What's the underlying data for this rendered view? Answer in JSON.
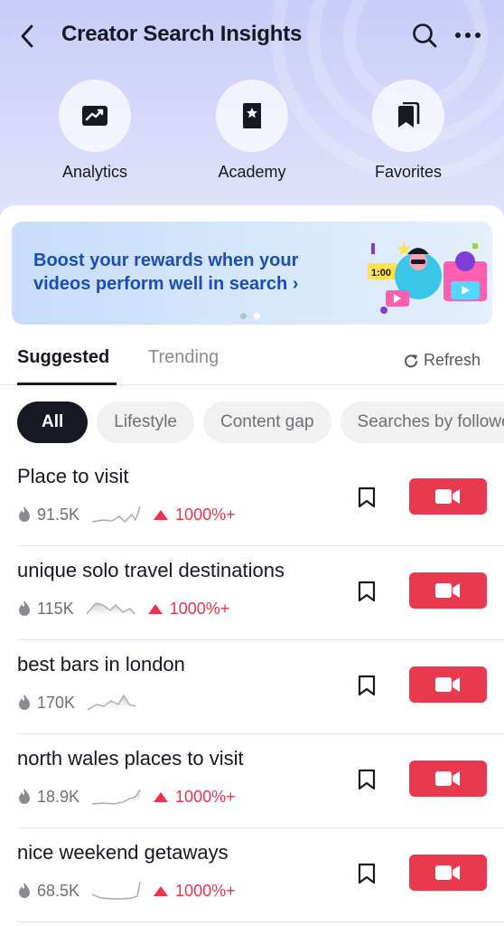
{
  "header": {
    "title": "Creator Search Insights",
    "icons": [
      "back-icon",
      "search-icon",
      "more-icon"
    ]
  },
  "shortcuts": [
    {
      "label": "Analytics",
      "icon": "analytics-icon"
    },
    {
      "label": "Academy",
      "icon": "academy-icon"
    },
    {
      "label": "Favorites",
      "icon": "favorites-icon"
    }
  ],
  "banner": {
    "line1": "Boost your rewards when your",
    "line2": "videos perform well in search",
    "arrow": "›",
    "art_time": "1:00",
    "page_count": 2,
    "active_page": 2
  },
  "tabs": [
    {
      "label": "Suggested",
      "active": true
    },
    {
      "label": "Trending",
      "active": false
    }
  ],
  "refresh_label": "Refresh",
  "chips": [
    {
      "label": "All",
      "active": true
    },
    {
      "label": "Lifestyle",
      "active": false
    },
    {
      "label": "Content gap",
      "active": false
    },
    {
      "label": "Searches by followers",
      "active": false
    }
  ],
  "results": [
    {
      "keyword": "Place to visit",
      "views": "91.5K",
      "trend": "1000%+"
    },
    {
      "keyword": "unique solo travel destinations",
      "views": "115K",
      "trend": "1000%+"
    },
    {
      "keyword": "best bars in london",
      "views": "170K",
      "trend": ""
    },
    {
      "keyword": "north wales places to visit",
      "views": "18.9K",
      "trend": "1000%+"
    },
    {
      "keyword": "nice weekend getaways",
      "views": "68.5K",
      "trend": "1000%+"
    }
  ],
  "colors": {
    "accent_red": "#e9394f",
    "banner_text": "#1c4db8",
    "trend_red": "#e8344e"
  }
}
